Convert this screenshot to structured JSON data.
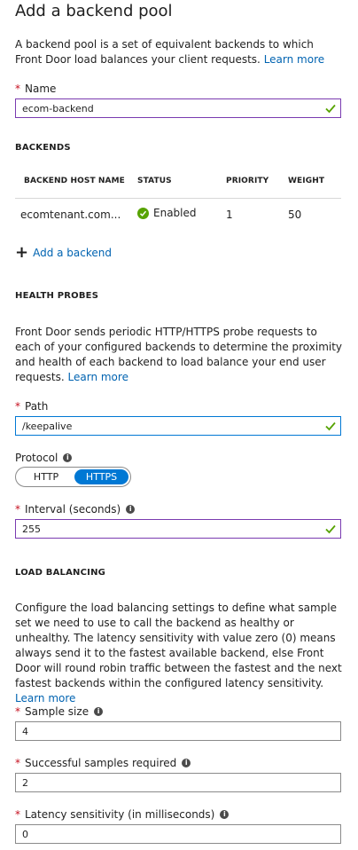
{
  "title": "Add a backend pool",
  "intro": {
    "text": "A backend pool is a set of equivalent backends to which Front Door load balances your client requests.",
    "link": "Learn more"
  },
  "name_field": {
    "label": "Name",
    "value": "ecom-backend"
  },
  "backends": {
    "heading": "BACKENDS",
    "columns": [
      "BACKEND HOST NAME",
      "STATUS",
      "PRIORITY",
      "WEIGHT"
    ],
    "rows": [
      {
        "host": "ecomtenant.com...",
        "status": "Enabled",
        "priority": "1",
        "weight": "50"
      }
    ],
    "add_label": "Add a backend"
  },
  "health_probes": {
    "heading": "HEALTH PROBES",
    "text": "Front Door sends periodic HTTP/HTTPS probe requests to each of your configured backends to determine the proximity and health of each backend to load balance your end user requests.",
    "link": "Learn more",
    "path": {
      "label": "Path",
      "value": "/keepalive"
    },
    "protocol": {
      "label": "Protocol",
      "options": [
        "HTTP",
        "HTTPS"
      ],
      "selected": "HTTPS"
    },
    "interval": {
      "label": "Interval (seconds)",
      "value": "255"
    }
  },
  "load_balancing": {
    "heading": "LOAD BALANCING",
    "text": "Configure the load balancing settings to define what sample set we need to use to call the backend as healthy or unhealthy. The latency sensitivity with value zero (0) means always send it to the fastest available backend, else Front Door will round robin traffic between the fastest and the next fastest backends within the configured latency sensitivity.",
    "link": "Learn more",
    "sample_size": {
      "label": "Sample size",
      "value": "4"
    },
    "successful_samples": {
      "label": "Successful samples required",
      "value": "2"
    },
    "latency": {
      "label": "Latency sensitivity (in milliseconds)",
      "value": "0"
    }
  },
  "colors": {
    "accent": "#0078d4",
    "link": "#0063b1",
    "valid_border": "#7a3bb0",
    "check": "#57a300",
    "required": "#c50f1f"
  }
}
